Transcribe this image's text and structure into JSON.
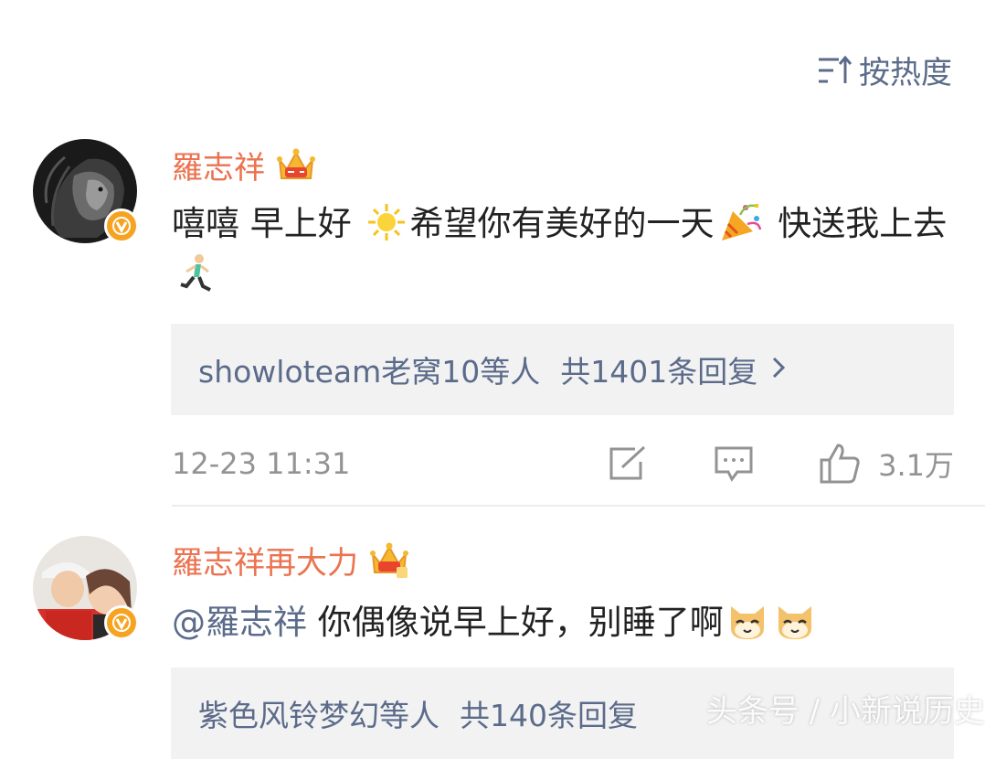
{
  "sort": {
    "label": "按热度",
    "icon": "sort-icon"
  },
  "comments": [
    {
      "username": "羅志祥",
      "text_a": "嘻嘻 早上好 ",
      "text_b": "希望你有美好的一天",
      "text_c": " 快送我上去",
      "replies_who": "showloteam老窝10等人",
      "replies_count": "共1401条回复",
      "time": "12-23 11:31",
      "likes": "3.1万"
    },
    {
      "username": "羅志祥再大力",
      "mention": "@羅志祥",
      "text": " 你偶像说早上好，别睡了啊",
      "replies_who": "紫色风铃梦幻等人",
      "replies_count": "共140条回复"
    }
  ],
  "watermark": "头条号 / 小新说历史",
  "colors": {
    "accent": "#eb7350",
    "link": "#5b6b8a",
    "meta": "#939393",
    "reply_bg": "#f2f2f2"
  }
}
